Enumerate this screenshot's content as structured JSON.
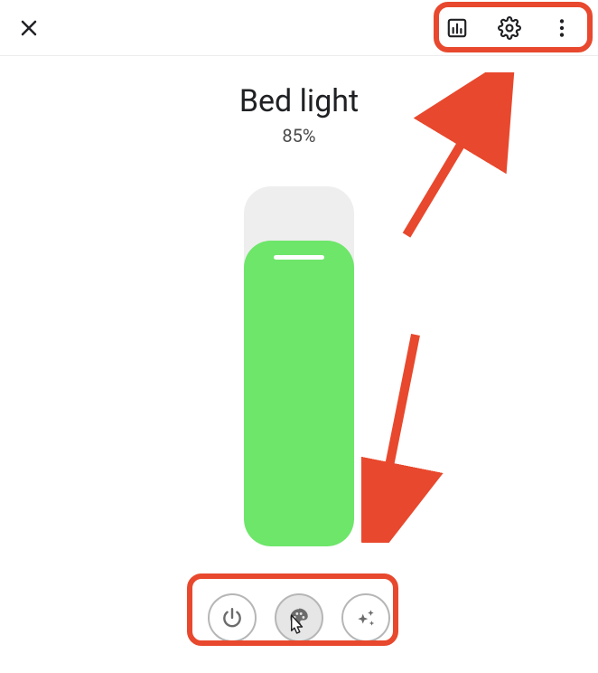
{
  "device": {
    "name": "Bed light",
    "brightness_pct": 85,
    "brightness_label": "85%",
    "fill_color": "#6de669"
  },
  "header_icons": {
    "close": "close-icon",
    "history": "history-icon",
    "settings": "gear-icon",
    "more": "more-vertical-icon"
  },
  "footer_icons": {
    "power": "power-icon",
    "color": "palette-icon",
    "effects": "sparkle-icon"
  }
}
